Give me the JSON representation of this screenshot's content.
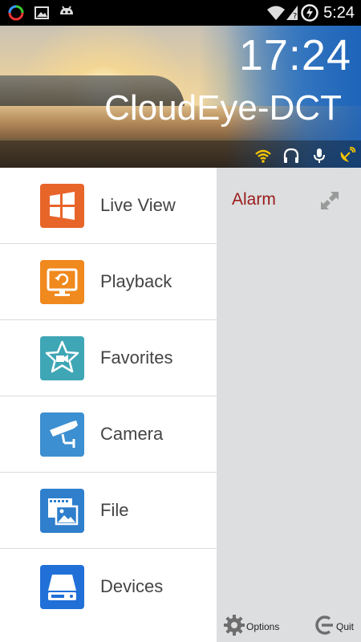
{
  "status_bar": {
    "time": "5:24"
  },
  "header": {
    "clock": "17:24",
    "device_name": "CloudEye-DCT"
  },
  "menu": {
    "items": [
      {
        "label": "Live View",
        "icon": "grid-windows-icon",
        "color": "#e8652a"
      },
      {
        "label": "Playback",
        "icon": "playback-monitor-icon",
        "color": "#f0891e"
      },
      {
        "label": "Favorites",
        "icon": "star-camera-icon",
        "color": "#3fa6b5"
      },
      {
        "label": "Camera",
        "icon": "security-camera-icon",
        "color": "#3c8fd0"
      },
      {
        "label": "File",
        "icon": "film-image-icon",
        "color": "#2f7fcc"
      },
      {
        "label": "Devices",
        "icon": "hard-drive-icon",
        "color": "#2070d8"
      }
    ]
  },
  "panel": {
    "alarm_label": "Alarm",
    "options_label": "Options",
    "quit_label": "Quit"
  },
  "colors": {
    "alarm_text": "#9b1b1b",
    "panel_bg": "#dcdedf",
    "status_icon_yellow": "#f5c400"
  }
}
